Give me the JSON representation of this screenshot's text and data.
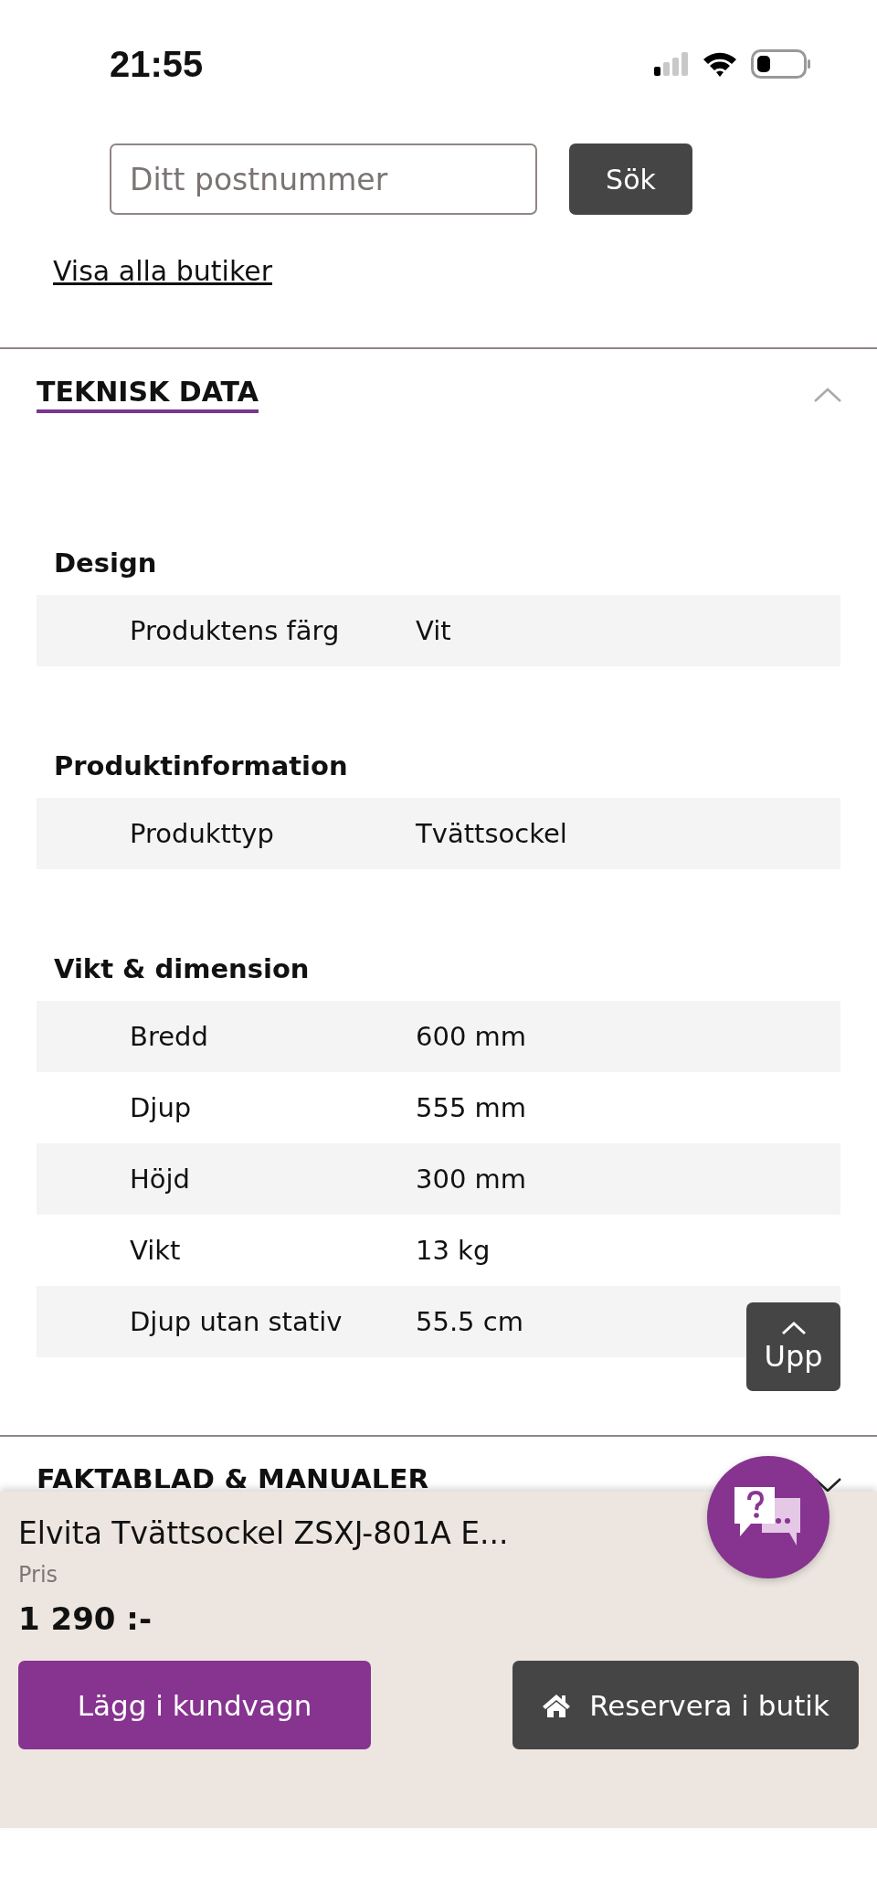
{
  "status_bar": {
    "time": "21:55"
  },
  "store_search": {
    "placeholder": "Ditt postnummer",
    "button": "Sök",
    "link": "Visa alla butiker"
  },
  "sections": [
    {
      "title": "TEKNISK DATA",
      "expanded": true,
      "groups": [
        {
          "title": "Design",
          "rows": [
            {
              "label": "Produktens färg",
              "value": "Vit"
            }
          ]
        },
        {
          "title": "Produktinformation",
          "rows": [
            {
              "label": "Produkttyp",
              "value": "Tvättsockel"
            }
          ]
        },
        {
          "title": "Vikt & dimension",
          "rows": [
            {
              "label": "Bredd",
              "value": "600 mm"
            },
            {
              "label": "Djup",
              "value": "555 mm"
            },
            {
              "label": "Höjd",
              "value": "300 mm"
            },
            {
              "label": "Vikt",
              "value": "13 kg"
            },
            {
              "label": "Djup utan stativ",
              "value": "55.5 cm"
            }
          ]
        }
      ]
    },
    {
      "title": "FAKTABLAD & MANUALER",
      "expanded": false
    }
  ],
  "scroll_top_button": "Upp",
  "product_bar": {
    "name": "Elvita Tvättsockel ZSXJ-801A E...",
    "price_label": "Pris",
    "price": "1 290 :-",
    "add_button": "Lägg i kundvagn",
    "reserve_button": "Reservera i butik"
  }
}
